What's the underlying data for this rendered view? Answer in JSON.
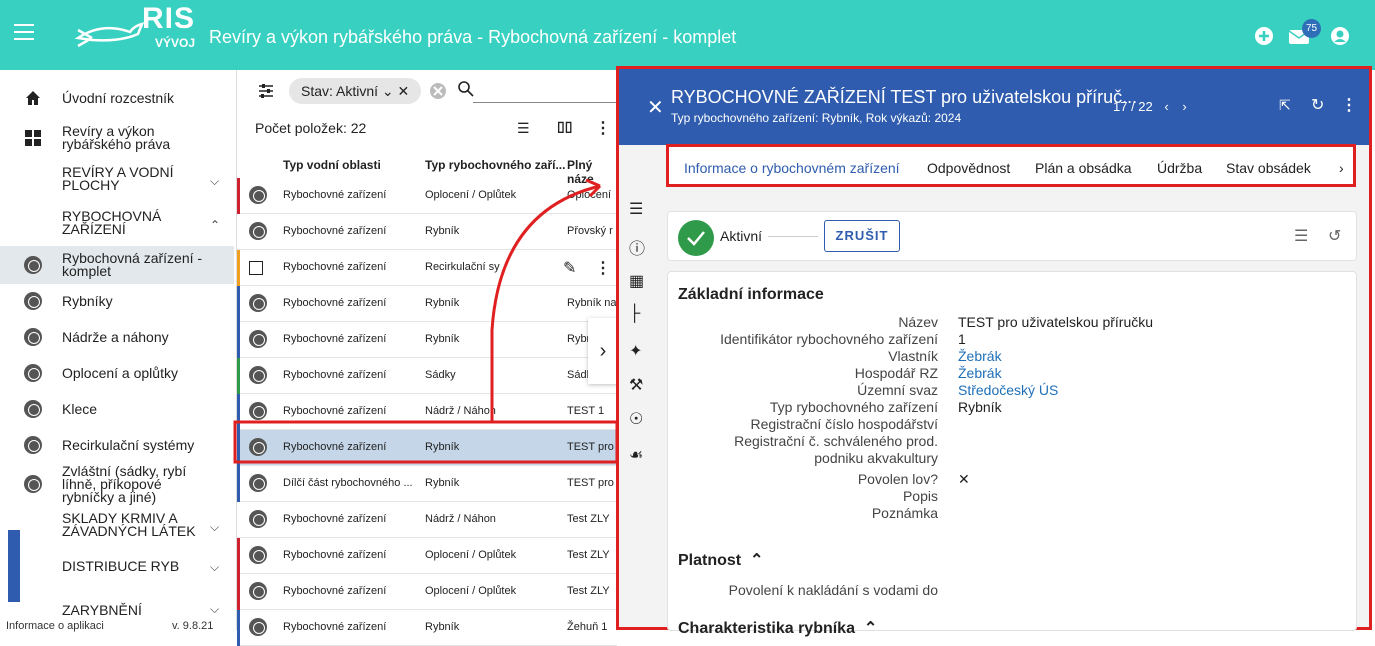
{
  "header": {
    "logo_text": "RIS",
    "logo_sub": "VÝVOJ",
    "title": "Revíry a výkon rybářského práva - Rybochovná zařízení - komplet",
    "notifications_count": "75",
    "color": "#38d0c0"
  },
  "sidebar": {
    "items": [
      {
        "label": "Úvodní rozcestník",
        "icon": "home-icon"
      },
      {
        "label": "Revíry a výkon rybářského práva",
        "icon": "grid-icon"
      }
    ],
    "sections": [
      {
        "label": "REVÍRY A VODNÍ PLOCHY"
      },
      {
        "label": "RYBOCHOVNÁ ZAŘÍZENÍ"
      },
      {
        "label": "SKLADY KRMIV A ZÁVADNÝCH LÁTEK"
      },
      {
        "label": "DISTRIBUCE RYB"
      },
      {
        "label": "ZARYBNĚNÍ"
      }
    ],
    "sub_items": [
      {
        "label": "Rybochovná zařízení - komplet"
      },
      {
        "label": "Rybníky"
      },
      {
        "label": "Nádrže a náhony"
      },
      {
        "label": "Oplocení a oplůtky"
      },
      {
        "label": "Klece"
      },
      {
        "label": "Recirkulační systémy"
      },
      {
        "label": "Zvláštní (sádky, rybí líhně, příkopové rybníčky a jiné)"
      }
    ],
    "footer": "Informace o aplikaci",
    "version": "v. 9.8.21"
  },
  "list": {
    "filter_chip": "Stav: Aktivní",
    "count_label": "Počet položek: 22",
    "columns": [
      "Typ vodní oblasti",
      "Typ rybochovného zaří...",
      "Plný náze"
    ],
    "rows": [
      {
        "a": "Rybochovné zařízení",
        "b": "Oplocení / Oplůtek",
        "c": "Oplocení",
        "bar": "#d02030"
      },
      {
        "a": "Rybochovné zařízení",
        "b": "Rybník",
        "c": "Přovský r",
        "bar": ""
      },
      {
        "a": "Rybochovné zařízení",
        "b": "Recirkulační sy",
        "c": "",
        "bar": "#f0a020"
      },
      {
        "a": "Rybochovné zařízení",
        "b": "Rybník",
        "c": "Rybník na",
        "bar": "#2f5cae"
      },
      {
        "a": "Rybochovné zařízení",
        "b": "Rybník",
        "c": "Rybr",
        "bar": "#2f5cae"
      },
      {
        "a": "Rybochovné zařízení",
        "b": "Sádky",
        "c": "Sádk",
        "bar": "#2f9a4a"
      },
      {
        "a": "Rybochovné zařízení",
        "b": "Nádrž / Náhon",
        "c": "TEST 1",
        "bar": "#2f5cae"
      },
      {
        "a": "Rybochovné zařízení",
        "b": "Rybník",
        "c": "TEST pro",
        "bar": "#2f5cae"
      },
      {
        "a": "Dílčí část rybochovného ...",
        "b": "Rybník",
        "c": "TEST pro",
        "bar": "#2f5cae"
      },
      {
        "a": "Rybochovné zařízení",
        "b": "Nádrž / Náhon",
        "c": "Test ZLY",
        "bar": ""
      },
      {
        "a": "Rybochovné zařízení",
        "b": "Oplocení / Oplůtek",
        "c": "Test ZLY",
        "bar": "#d02030"
      },
      {
        "a": "Rybochovné zařízení",
        "b": "Oplocení / Oplůtek",
        "c": "Test ZLY",
        "bar": "#d02030"
      },
      {
        "a": "Rybochovné zařízení",
        "b": "Rybník",
        "c": "Žehuň 1",
        "bar": "#2f5cae"
      }
    ]
  },
  "panel": {
    "title": "RYBOCHOVNÉ ZAŘÍZENÍ TEST pro uživatelskou příruč...",
    "subtitle": "Typ rybochovného zařízení: Rybník, Rok výkazů: 2024",
    "pager": "17 / 22",
    "tabs": [
      "Informace o rybochovném zařízení",
      "Odpovědnost",
      "Plán a obsádka",
      "Údržba",
      "Stav obsádek"
    ],
    "status": "Aktivní",
    "cancel_label": "ZRUŠIT",
    "section_basic": "Základní informace",
    "fields": [
      {
        "label": "Název",
        "value": "TEST pro uživatelskou příručku",
        "link": false
      },
      {
        "label": "Identifikátor rybochovného zařízení",
        "value": "1",
        "link": false
      },
      {
        "label": "Vlastník",
        "value": "Žebrák",
        "link": true
      },
      {
        "label": "Hospodář RZ",
        "value": "Žebrák",
        "link": true
      },
      {
        "label": "Územní svaz",
        "value": "Středočeský ÚS",
        "link": true
      },
      {
        "label": "Typ rybochovného zařízení",
        "value": "Rybník",
        "link": false
      },
      {
        "label": "Registrační číslo hospodářství",
        "value": "",
        "link": false
      },
      {
        "label": "Registrační č. schváleného prod.",
        "value": "",
        "link": false
      },
      {
        "label": "podniku akvakultury",
        "value": "",
        "link": false
      },
      {
        "label": "Povolen lov?",
        "value": "✕",
        "link": false
      },
      {
        "label": "Popis",
        "value": "",
        "link": false
      },
      {
        "label": "Poznámka",
        "value": "",
        "link": false
      }
    ],
    "section_validity": "Platnost",
    "validity_field": "Povolení k nakládání s vodami do",
    "section_char": "Charakteristika rybníka"
  }
}
